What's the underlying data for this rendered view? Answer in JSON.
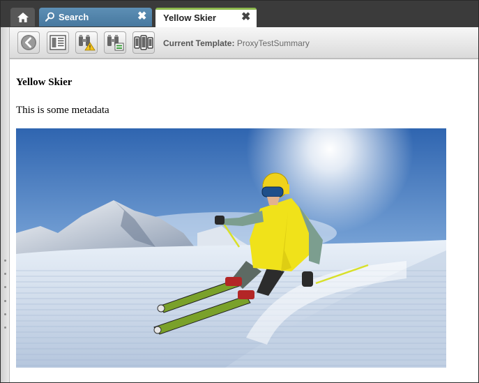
{
  "tabs": {
    "search_label": "Search",
    "active_label": "Yellow Skier"
  },
  "icons": {
    "home": "home-icon",
    "search": "search-icon",
    "close": "close-icon",
    "back": "back-arrow-icon",
    "summary": "document-list-icon",
    "find_warning": "binoculars-warning-icon",
    "find_export": "binoculars-export-icon",
    "devices": "devices-icon"
  },
  "toolbar": {
    "template_label": "Current Template:",
    "template_value": "ProxyTestSummary"
  },
  "content": {
    "title": "Yellow Skier",
    "metadata": "This is some metadata"
  },
  "colors": {
    "tab_search": "#4f82a9",
    "tab_active_accent": "#8cb84c",
    "tabbar_bg": "#3b3b3b",
    "jacket": "#f0e21a"
  }
}
